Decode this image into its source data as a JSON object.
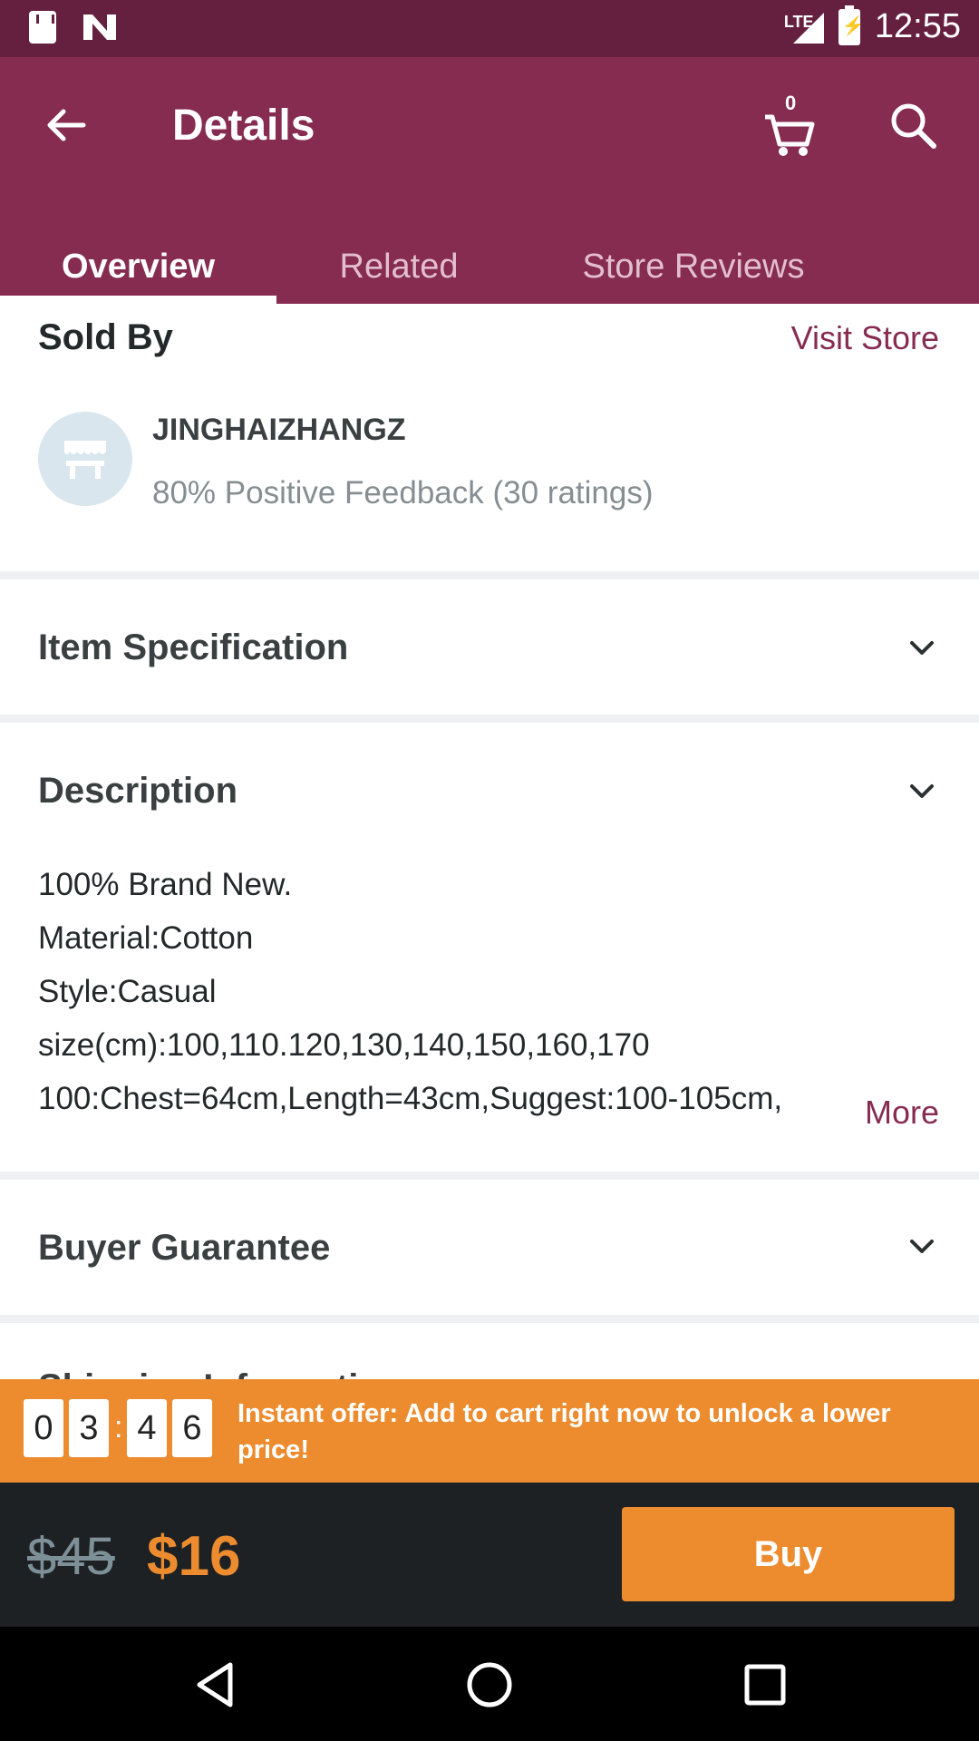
{
  "status_bar": {
    "time": "12:55",
    "network": "LTE"
  },
  "app_bar": {
    "title": "Details",
    "cart_count": "0"
  },
  "tabs": [
    {
      "label": "Overview"
    },
    {
      "label": "Related"
    },
    {
      "label": "Store Reviews"
    }
  ],
  "sold_by": {
    "title": "Sold By",
    "visit_store": "Visit Store",
    "store_name": "JINGHAIZHANGZ",
    "feedback": "80% Positive Feedback (30 ratings)"
  },
  "item_specification": {
    "title": "Item Specification"
  },
  "description": {
    "title": "Description",
    "lines": [
      "100% Brand New.",
      "Material:Cotton",
      "Style:Casual",
      "size(cm):100,110.120,130,140,150,160,170",
      "100:Chest=64cm,Length=43cm,Suggest:100-105cm,"
    ],
    "more": "More"
  },
  "buyer_guarantee": {
    "title": "Buyer Guarantee"
  },
  "shipping": {
    "title": "Shipping Information"
  },
  "offer": {
    "timer_digits": [
      "0",
      "3",
      "4",
      "6"
    ],
    "separator": ":",
    "text": "Instant offer: Add to cart right now to unlock a lower price!"
  },
  "price": {
    "old": "$45",
    "new": "$16",
    "buy_label": "Buy"
  },
  "colors": {
    "brand": "#862c51",
    "accent": "#ec8c2f",
    "status_bar": "#65203f"
  }
}
